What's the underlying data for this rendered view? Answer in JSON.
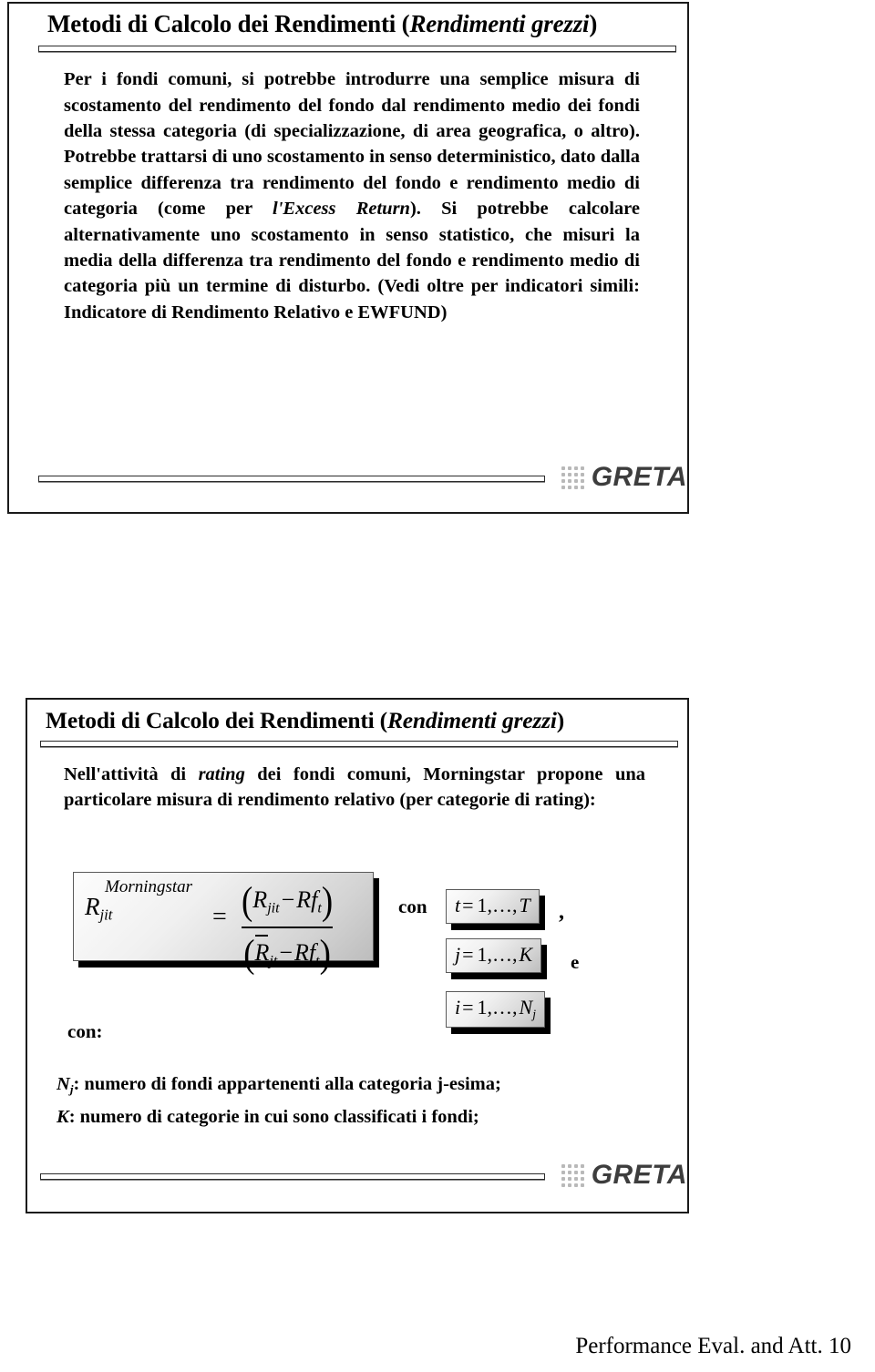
{
  "document": {
    "footer": "Performance Eval. and Att. 10"
  },
  "slides": [
    {
      "title_main": "Metodi di Calcolo dei Rendimenti (",
      "title_italic": "Rendimenti grezzi",
      "title_close": ")",
      "body_part1": "Per i fondi comuni, si potrebbe introdurre una semplice misura di scostamento del rendimento del fondo dal rendimento medio dei fondi della stessa categoria (di specializzazione, di area geografica, o altro). Potrebbe trattarsi di uno scostamento in senso deterministico, dato dalla semplice differenza  tra rendimento del fondo e rendimento medio di categoria (come per ",
      "body_italic1": "l'Excess Return",
      "body_part2": "). Si potrebbe calcolare alternativamente uno scostamento in senso statistico, che misuri la media della differenza tra rendimento del fondo e rendimento medio di categoria più un termine di disturbo. (Vedi oltre per indicatori simili: Indicatore di Rendimento Relativo e EWFUND)",
      "logo": "GRETA"
    },
    {
      "title_main": "Metodi di Calcolo dei Rendimenti (",
      "title_italic": "Rendimenti grezzi",
      "title_close": ")",
      "body_part1": "Nell'attività di ",
      "body_italic1": "rating",
      "body_part2": " dei fondi comuni, Morningstar propone una particolare misura di rendimento relativo (per categorie di rating):",
      "logo": "GRETA"
    }
  ],
  "formula": {
    "lhs_superscript": "Morningstar",
    "lhs_base": "R",
    "lhs_sub": "jit",
    "equals": "=",
    "numerator": {
      "open": "(",
      "term1": "R",
      "term1_sub": "jit",
      "minus": "−",
      "term2": "Rf",
      "term2_sub": "t",
      "close": ")"
    },
    "denominator": {
      "open": "(",
      "term1": "R",
      "term1_sub": "jt",
      "minus": "−",
      "term2": "Rf",
      "term2_sub": "t",
      "close": ")"
    }
  },
  "index_boxes": [
    {
      "var": "t",
      "eq": "=",
      "range": "1,…,",
      "limit": "T",
      "limit_sub": ""
    },
    {
      "var": "j",
      "eq": "=",
      "range": "1,…,",
      "limit": "K",
      "limit_sub": ""
    },
    {
      "var": "i",
      "eq": "=",
      "range": "1,…,",
      "limit": "N",
      "limit_sub": "j"
    }
  ],
  "labels": {
    "con": "con",
    "comma": ",",
    "e": "e",
    "con_colon": "con:"
  },
  "definitions": [
    {
      "symbol": "N",
      "symbol_sub": "j",
      "text": ": numero di fondi appartenenti alla categoria j-esima;"
    },
    {
      "symbol": "K",
      "symbol_sub": "",
      "text": ": numero di categorie in cui sono classificati i fondi;"
    }
  ]
}
